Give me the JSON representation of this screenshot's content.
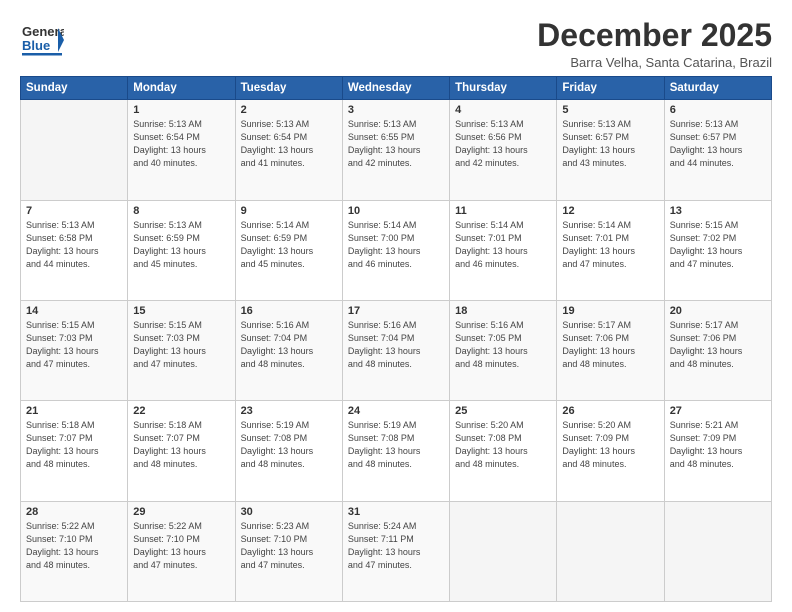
{
  "header": {
    "logo_general": "General",
    "logo_blue": "Blue",
    "month_year": "December 2025",
    "location": "Barra Velha, Santa Catarina, Brazil"
  },
  "days_of_week": [
    "Sunday",
    "Monday",
    "Tuesday",
    "Wednesday",
    "Thursday",
    "Friday",
    "Saturday"
  ],
  "weeks": [
    [
      {
        "day": "",
        "info": ""
      },
      {
        "day": "1",
        "info": "Sunrise: 5:13 AM\nSunset: 6:54 PM\nDaylight: 13 hours\nand 40 minutes."
      },
      {
        "day": "2",
        "info": "Sunrise: 5:13 AM\nSunset: 6:54 PM\nDaylight: 13 hours\nand 41 minutes."
      },
      {
        "day": "3",
        "info": "Sunrise: 5:13 AM\nSunset: 6:55 PM\nDaylight: 13 hours\nand 42 minutes."
      },
      {
        "day": "4",
        "info": "Sunrise: 5:13 AM\nSunset: 6:56 PM\nDaylight: 13 hours\nand 42 minutes."
      },
      {
        "day": "5",
        "info": "Sunrise: 5:13 AM\nSunset: 6:57 PM\nDaylight: 13 hours\nand 43 minutes."
      },
      {
        "day": "6",
        "info": "Sunrise: 5:13 AM\nSunset: 6:57 PM\nDaylight: 13 hours\nand 44 minutes."
      }
    ],
    [
      {
        "day": "7",
        "info": "Sunrise: 5:13 AM\nSunset: 6:58 PM\nDaylight: 13 hours\nand 44 minutes."
      },
      {
        "day": "8",
        "info": "Sunrise: 5:13 AM\nSunset: 6:59 PM\nDaylight: 13 hours\nand 45 minutes."
      },
      {
        "day": "9",
        "info": "Sunrise: 5:14 AM\nSunset: 6:59 PM\nDaylight: 13 hours\nand 45 minutes."
      },
      {
        "day": "10",
        "info": "Sunrise: 5:14 AM\nSunset: 7:00 PM\nDaylight: 13 hours\nand 46 minutes."
      },
      {
        "day": "11",
        "info": "Sunrise: 5:14 AM\nSunset: 7:01 PM\nDaylight: 13 hours\nand 46 minutes."
      },
      {
        "day": "12",
        "info": "Sunrise: 5:14 AM\nSunset: 7:01 PM\nDaylight: 13 hours\nand 47 minutes."
      },
      {
        "day": "13",
        "info": "Sunrise: 5:15 AM\nSunset: 7:02 PM\nDaylight: 13 hours\nand 47 minutes."
      }
    ],
    [
      {
        "day": "14",
        "info": "Sunrise: 5:15 AM\nSunset: 7:03 PM\nDaylight: 13 hours\nand 47 minutes."
      },
      {
        "day": "15",
        "info": "Sunrise: 5:15 AM\nSunset: 7:03 PM\nDaylight: 13 hours\nand 47 minutes."
      },
      {
        "day": "16",
        "info": "Sunrise: 5:16 AM\nSunset: 7:04 PM\nDaylight: 13 hours\nand 48 minutes."
      },
      {
        "day": "17",
        "info": "Sunrise: 5:16 AM\nSunset: 7:04 PM\nDaylight: 13 hours\nand 48 minutes."
      },
      {
        "day": "18",
        "info": "Sunrise: 5:16 AM\nSunset: 7:05 PM\nDaylight: 13 hours\nand 48 minutes."
      },
      {
        "day": "19",
        "info": "Sunrise: 5:17 AM\nSunset: 7:06 PM\nDaylight: 13 hours\nand 48 minutes."
      },
      {
        "day": "20",
        "info": "Sunrise: 5:17 AM\nSunset: 7:06 PM\nDaylight: 13 hours\nand 48 minutes."
      }
    ],
    [
      {
        "day": "21",
        "info": "Sunrise: 5:18 AM\nSunset: 7:07 PM\nDaylight: 13 hours\nand 48 minutes."
      },
      {
        "day": "22",
        "info": "Sunrise: 5:18 AM\nSunset: 7:07 PM\nDaylight: 13 hours\nand 48 minutes."
      },
      {
        "day": "23",
        "info": "Sunrise: 5:19 AM\nSunset: 7:08 PM\nDaylight: 13 hours\nand 48 minutes."
      },
      {
        "day": "24",
        "info": "Sunrise: 5:19 AM\nSunset: 7:08 PM\nDaylight: 13 hours\nand 48 minutes."
      },
      {
        "day": "25",
        "info": "Sunrise: 5:20 AM\nSunset: 7:08 PM\nDaylight: 13 hours\nand 48 minutes."
      },
      {
        "day": "26",
        "info": "Sunrise: 5:20 AM\nSunset: 7:09 PM\nDaylight: 13 hours\nand 48 minutes."
      },
      {
        "day": "27",
        "info": "Sunrise: 5:21 AM\nSunset: 7:09 PM\nDaylight: 13 hours\nand 48 minutes."
      }
    ],
    [
      {
        "day": "28",
        "info": "Sunrise: 5:22 AM\nSunset: 7:10 PM\nDaylight: 13 hours\nand 48 minutes."
      },
      {
        "day": "29",
        "info": "Sunrise: 5:22 AM\nSunset: 7:10 PM\nDaylight: 13 hours\nand 47 minutes."
      },
      {
        "day": "30",
        "info": "Sunrise: 5:23 AM\nSunset: 7:10 PM\nDaylight: 13 hours\nand 47 minutes."
      },
      {
        "day": "31",
        "info": "Sunrise: 5:24 AM\nSunset: 7:11 PM\nDaylight: 13 hours\nand 47 minutes."
      },
      {
        "day": "",
        "info": ""
      },
      {
        "day": "",
        "info": ""
      },
      {
        "day": "",
        "info": ""
      }
    ]
  ]
}
